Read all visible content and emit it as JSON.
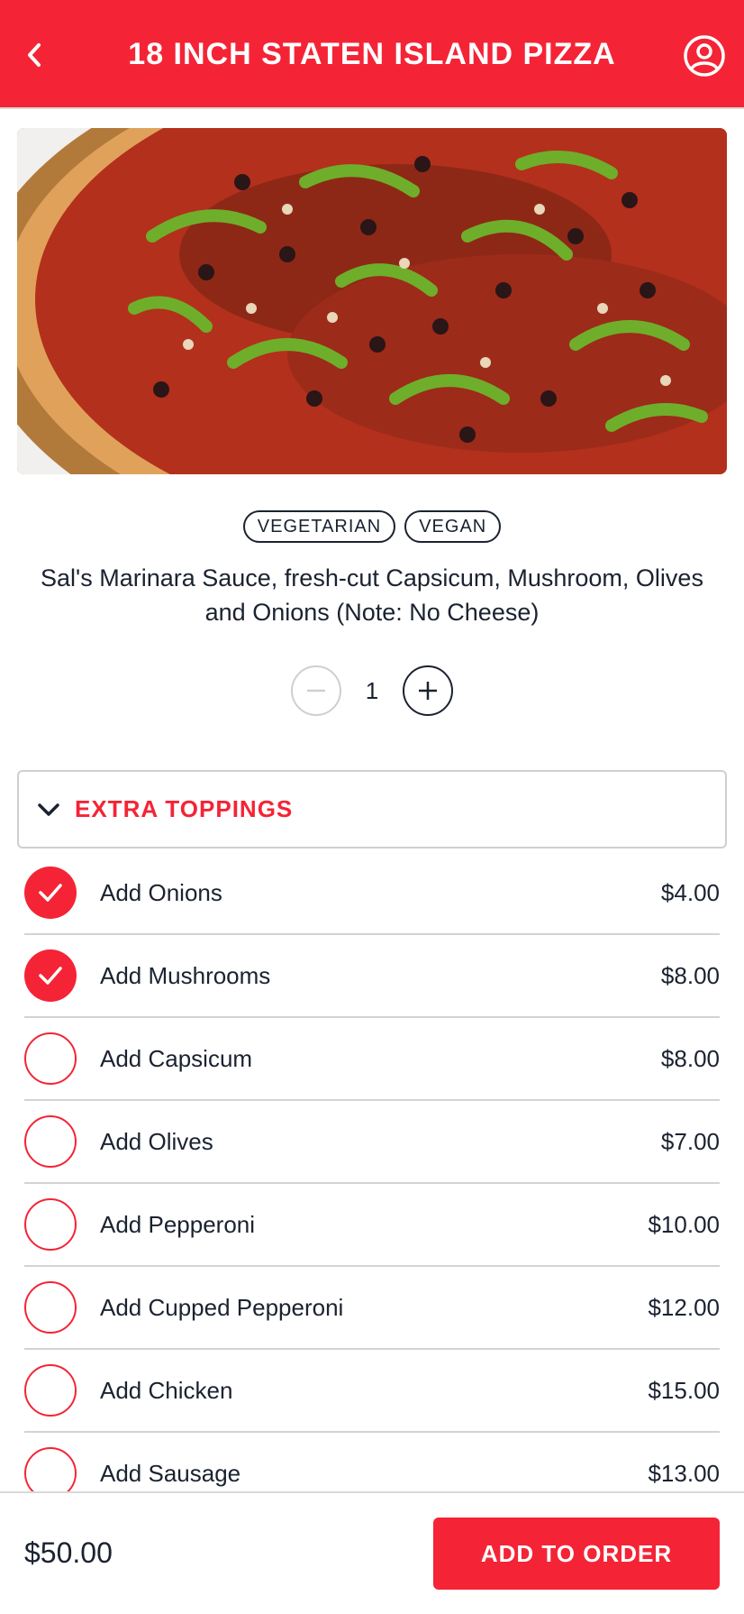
{
  "header": {
    "title": "18 INCH STATEN ISLAND PIZZA"
  },
  "icons": {
    "back": "chevron-left-icon",
    "account": "user-circle-icon",
    "section_toggle": "chevron-down-icon",
    "check": "checkmark-icon"
  },
  "colors": {
    "brand": "#f42436",
    "text": "#1b2230",
    "divider": "#d3d3d3"
  },
  "product": {
    "tags": [
      "VEGETARIAN",
      "VEGAN"
    ],
    "description": "Sal's Marinara Sauce, fresh-cut Capsicum, Mushroom, Olives and Onions (Note: No Cheese)",
    "quantity": "1"
  },
  "section": {
    "title": "EXTRA TOPPINGS"
  },
  "options": [
    {
      "label": "Add Onions",
      "price": "$4.00",
      "checked": true
    },
    {
      "label": "Add Mushrooms",
      "price": "$8.00",
      "checked": true
    },
    {
      "label": "Add Capsicum",
      "price": "$8.00",
      "checked": false
    },
    {
      "label": "Add Olives",
      "price": "$7.00",
      "checked": false
    },
    {
      "label": "Add Pepperoni",
      "price": "$10.00",
      "checked": false
    },
    {
      "label": "Add Cupped Pepperoni",
      "price": "$12.00",
      "checked": false
    },
    {
      "label": "Add Chicken",
      "price": "$15.00",
      "checked": false
    },
    {
      "label": "Add Sausage",
      "price": "$13.00",
      "checked": false
    }
  ],
  "footer": {
    "total": "$50.00",
    "button": "ADD TO ORDER"
  }
}
